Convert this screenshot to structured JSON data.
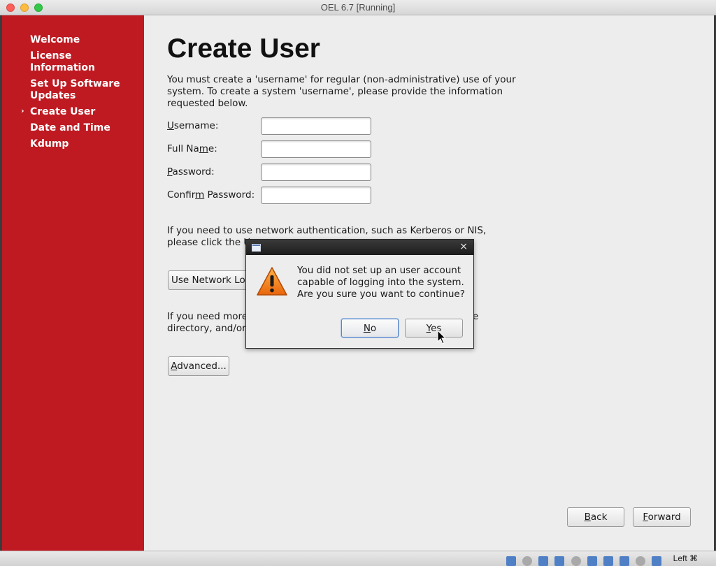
{
  "window": {
    "title": "OEL 6.7 [Running]"
  },
  "sidebar": {
    "items": [
      {
        "label_lines": [
          "Welcome"
        ]
      },
      {
        "label_lines": [
          "License",
          "Information"
        ]
      },
      {
        "label_lines": [
          "Set Up Software",
          "Updates"
        ]
      },
      {
        "label_lines": [
          "Create User"
        ],
        "current": true
      },
      {
        "label_lines": [
          "Date and Time"
        ]
      },
      {
        "label_lines": [
          "Kdump"
        ]
      }
    ],
    "current_marker": "›"
  },
  "main": {
    "title": "Create User",
    "intro_lines": [
      "You must create a 'username' for regular (non-administrative) use of your",
      "system.  To create a system 'username', please provide the information",
      "requested below."
    ],
    "fields": [
      {
        "label_pre": "",
        "label_mnemonic": "U",
        "label_post": "sername:",
        "value": ""
      },
      {
        "label_pre": "Full Na",
        "label_mnemonic": "m",
        "label_post": "e:",
        "value": ""
      },
      {
        "label_pre": "",
        "label_mnemonic": "P",
        "label_post": "assword:",
        "value": ""
      },
      {
        "label_pre": "Confir",
        "label_mnemonic": "m",
        "label_post": " Password:",
        "value": ""
      }
    ],
    "network_text_lines": [
      "If you need to use network authentication, such as Kerberos or NIS,",
      "please click the U"
    ],
    "network_button_label": "Use Network Lo",
    "more_text_lines": [
      "If you need more",
      "directory, and/or"
    ],
    "more_text_right_fragment": "e",
    "advanced_button": {
      "mnemonic": "A",
      "rest": "dvanced..."
    }
  },
  "dialog": {
    "message_lines": [
      "You did not set up an user account",
      "capable of logging into the system.",
      "Are you sure you want to continue?"
    ],
    "no_button": {
      "mnemonic": "N",
      "rest": "o"
    },
    "yes_button": {
      "mnemonic": "Y",
      "rest": "es"
    },
    "close_glyph": "×",
    "icon": "warning-icon"
  },
  "nav": {
    "back_button": {
      "mnemonic": "B",
      "rest": "ack"
    },
    "forward_button": {
      "mnemonic": "F",
      "rest": "orward"
    }
  },
  "statusbar": {
    "host_key": "Left ⌘"
  },
  "colors": {
    "sidebar": "#bf1a22",
    "background": "#ededed"
  }
}
